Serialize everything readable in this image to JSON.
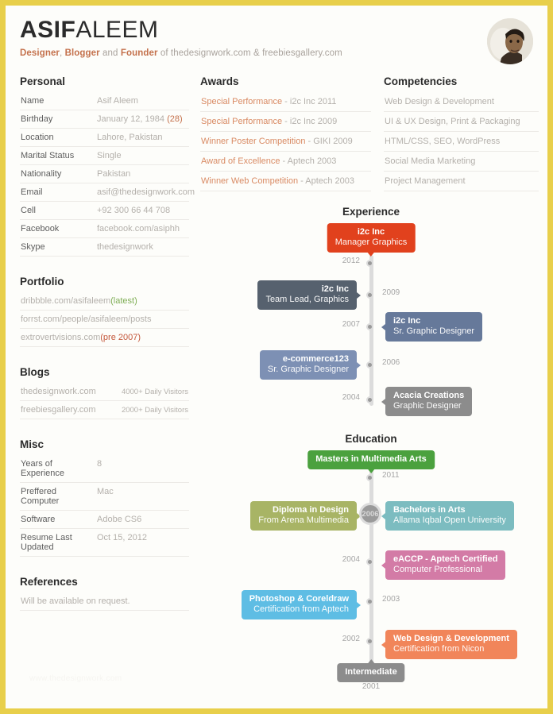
{
  "header": {
    "first_name": "ASIF",
    "last_name": "ALEEM",
    "tag_1": "Designer",
    "tag_sep_1": ", ",
    "tag_2": "Blogger",
    "tag_and": " and ",
    "tag_3": "Founder",
    "tag_rest": " of thedesignwork.com & freebiesgallery.com",
    "avatar_alt": "avatar-photo"
  },
  "personal": {
    "title": "Personal",
    "rows": [
      {
        "label": "Name",
        "value": "Asif Aleem"
      },
      {
        "label": "Birthday",
        "value": "January 12, 1984",
        "accent": "(28)"
      },
      {
        "label": "Location",
        "value": "Lahore, Pakistan"
      },
      {
        "label": "Marital Status",
        "value": "Single"
      },
      {
        "label": "Nationality",
        "value": "Pakistan"
      },
      {
        "label": "Email",
        "value": "asif@thedesignwork.com"
      },
      {
        "label": "Cell",
        "value": "+92 300 66 44 708"
      },
      {
        "label": "Facebook",
        "value": "facebook.com/asiphh"
      },
      {
        "label": "Skype",
        "value": "thedesignwork"
      }
    ]
  },
  "portfolio": {
    "title": "Portfolio",
    "rows": [
      {
        "label": "dribbble.com/asifaleem",
        "tag": "(latest)",
        "tag_color": "green"
      },
      {
        "label": "forrst.com/people/asifaleem/posts",
        "tag": "",
        "tag_color": ""
      },
      {
        "label": "extrovertvisions.com",
        "tag": "(pre 2007)",
        "tag_color": "red"
      }
    ]
  },
  "blogs": {
    "title": "Blogs",
    "rows": [
      {
        "label": "thedesignwork.com",
        "value": "4000+ Daily Visitors"
      },
      {
        "label": "freebiesgallery.com",
        "value": "2000+ Daily Visitors"
      }
    ]
  },
  "misc": {
    "title": "Misc",
    "rows": [
      {
        "label": "Years of Experience",
        "value": "8"
      },
      {
        "label": "Preffered Computer",
        "value": "Mac"
      },
      {
        "label": "Software",
        "value": "Adobe CS6"
      },
      {
        "label": "Resume Last Updated",
        "value": "Oct 15, 2012"
      }
    ]
  },
  "references": {
    "title": "References",
    "text": "Will be available on request."
  },
  "awards": {
    "title": "Awards",
    "items": [
      {
        "name": "Special Performance",
        "meta": " - i2c Inc 2011"
      },
      {
        "name": "Special Performance",
        "meta": " - i2c Inc 2009"
      },
      {
        "name": "Winner Poster Competition",
        "meta": " - GIKI 2009"
      },
      {
        "name": "Award of Excellence",
        "meta": " - Aptech 2003"
      },
      {
        "name": "Winner Web Competition",
        "meta": " - Aptech 2003"
      }
    ]
  },
  "competencies": {
    "title": "Competencies",
    "items": [
      "Web Design & Development",
      "UI & UX Design, Print & Packaging",
      "HTML/CSS, SEO, WordPress",
      "Social Media Marketing",
      "Project Management"
    ]
  },
  "experience": {
    "title": "Experience",
    "items": [
      {
        "org": "i2c Inc",
        "role": "Manager Graphics",
        "year": "2012",
        "color": "#e1411d",
        "side": "top"
      },
      {
        "org": "i2c Inc",
        "role": "Team Lead, Graphics",
        "year": "2009",
        "color": "#56616e",
        "side": "left"
      },
      {
        "org": "i2c Inc",
        "role": "Sr. Graphic Designer",
        "year": "2007",
        "color": "#66799a",
        "side": "right"
      },
      {
        "org": "e-commerce123",
        "role": "Sr. Graphic Designer",
        "year": "2006",
        "color": "#7d90b4",
        "side": "left"
      },
      {
        "org": "Acacia Creations",
        "role": "Graphic Designer",
        "year": "2004",
        "color": "#8c8c8c",
        "side": "right"
      }
    ]
  },
  "education": {
    "title": "Education",
    "items": [
      {
        "org": "Masters in Multimedia Arts",
        "role": "",
        "year": "2011",
        "color": "#4ba13e",
        "side": "top"
      },
      {
        "org": "Diploma in Design",
        "role": "From Arena Multimedia",
        "year": "2006",
        "color": "#a8b465",
        "side": "left"
      },
      {
        "org": "Bachelors in Arts",
        "role": "Allama Iqbal Open University",
        "year": "2006",
        "color": "#7cbcc0",
        "side": "right"
      },
      {
        "org": "eACCP - Aptech Certified",
        "role": "Computer Professional",
        "year": "2004",
        "color": "#d37ba6",
        "side": "right"
      },
      {
        "org": "Photoshop & Coreldraw",
        "role": "Certification from Aptech",
        "year": "2003",
        "color": "#5ebde4",
        "side": "left"
      },
      {
        "org": "Web Design & Development",
        "role": "Certification from Nicon",
        "year": "2002",
        "color": "#f1855a",
        "side": "right"
      },
      {
        "org": "Intermediate",
        "role": "",
        "year": "2001",
        "color": "#8c8c8c",
        "side": "bottom"
      }
    ]
  },
  "watermark": {
    "text": "www.thedesignwork.com"
  },
  "colors": {
    "border": "#e8cf4b",
    "accent_orange": "#c4714c",
    "award_name": "#d98a63",
    "green_tag": "#7fae55",
    "red_tag": "#c4563a",
    "spine": "#dcdcdc"
  }
}
